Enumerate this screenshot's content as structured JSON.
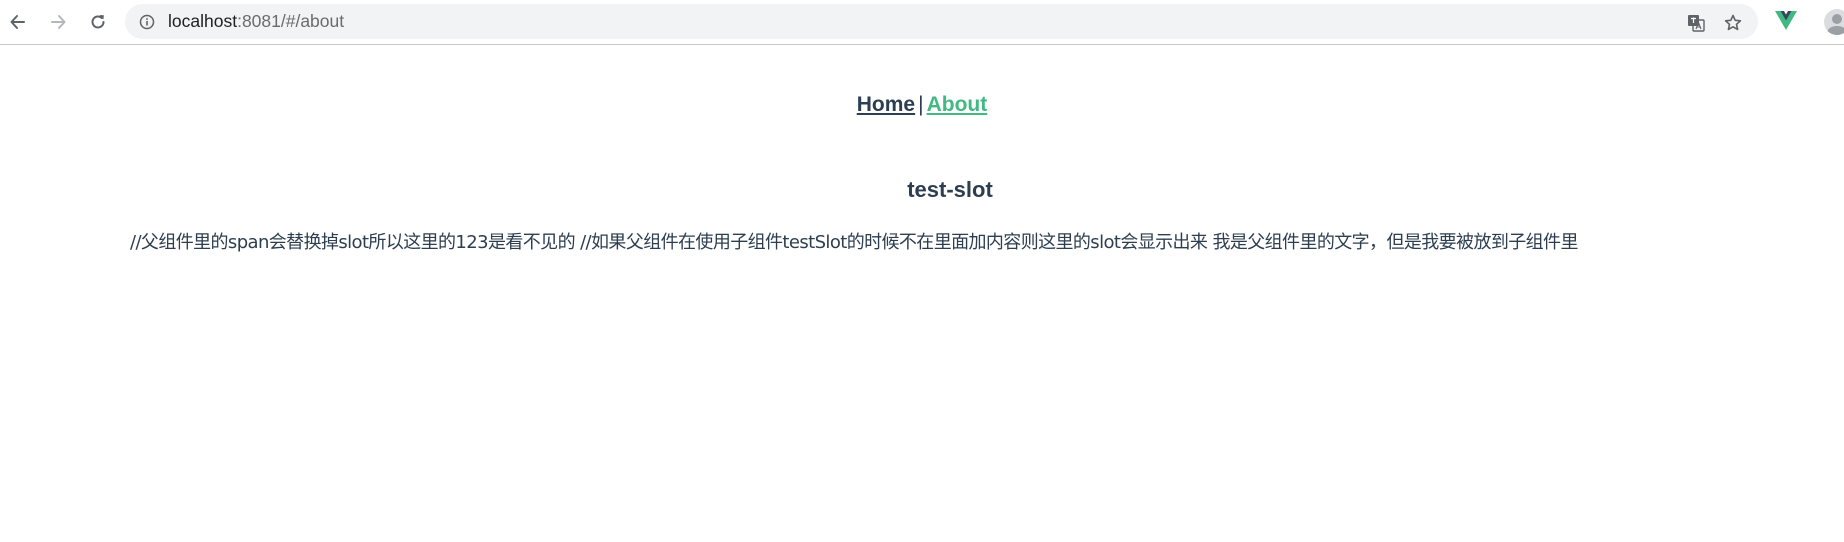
{
  "browser": {
    "url_host": "localhost",
    "url_rest": ":8081/#/about"
  },
  "nav": {
    "home_label": "Home",
    "separator": "|",
    "about_label": "About",
    "active_color": "#42b983",
    "text_color": "#2c3e50"
  },
  "main": {
    "heading": "test-slot",
    "paragraph": "//父组件里的span会替换掉slot所以这里的123是看不见的 //如果父组件在使用子组件testSlot的时候不在里面加内容则这里的slot会显示出来 我是父组件里的文字，但是我要被放到子组件里"
  }
}
